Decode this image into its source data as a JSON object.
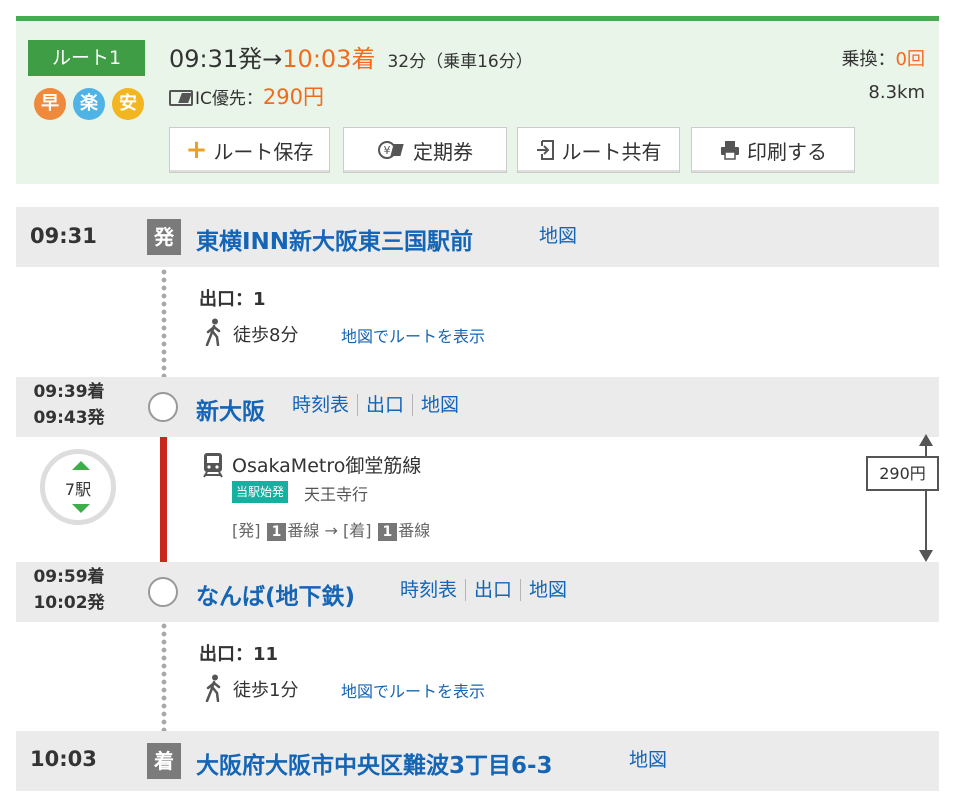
{
  "summary": {
    "route_label": "ルート1",
    "badges": [
      "早",
      "楽",
      "安"
    ],
    "departure": "09:31発",
    "arrow": "→",
    "arrival": "10:03着",
    "duration": "32分（乗車16分）",
    "transfer_label": "乗換：",
    "transfer_count": "0回",
    "fare_label": "IC優先：",
    "fare_value": "290円",
    "distance": "8.3km",
    "buttons": {
      "save": "ルート保存",
      "teiki": "定期券",
      "share": "ルート共有",
      "print": "印刷する"
    }
  },
  "stops": {
    "start": {
      "time": "09:31",
      "mark": "発",
      "name": "東横INN新大阪東三国駅前",
      "map": "地図"
    },
    "shin_osaka": {
      "arr": "09:39着",
      "dep": "09:43発",
      "name": "新大阪",
      "links": [
        "時刻表",
        "出口",
        "地図"
      ]
    },
    "namba": {
      "arr": "09:59着",
      "dep": "10:02発",
      "name": "なんば(地下鉄)",
      "links": [
        "時刻表",
        "出口",
        "地図"
      ]
    },
    "goal": {
      "time": "10:03",
      "mark": "着",
      "name": "大阪府大阪市中央区難波3丁目6-3",
      "map": "地図"
    }
  },
  "walk1": {
    "exit": "出口：1",
    "text": "徒歩8分",
    "link": "地図でルートを表示"
  },
  "walk2": {
    "exit": "出口：11",
    "text": "徒歩1分",
    "link": "地図でルートを表示"
  },
  "train": {
    "station_count": "7駅",
    "line": "OsakaMetro御堂筋線",
    "origin_badge": "当駅始発",
    "direction": "天王寺行",
    "dep_label": "[発]",
    "dep_platform": "1",
    "track_suffix": "番線",
    "arrow": "→",
    "arr_label": "[着]",
    "arr_platform": "1",
    "fare": "290円"
  },
  "colors": {
    "accent_green": "#3f9e45",
    "orange": "#f26b1d",
    "link_blue": "#1565b6",
    "rail_red": "#c9261e",
    "origin_teal": "#14b1a0"
  },
  "icons": [
    "plus-icon",
    "yen-pass-icon",
    "share-icon",
    "printer-icon",
    "ic-card-icon",
    "walk-icon",
    "train-icon"
  ]
}
